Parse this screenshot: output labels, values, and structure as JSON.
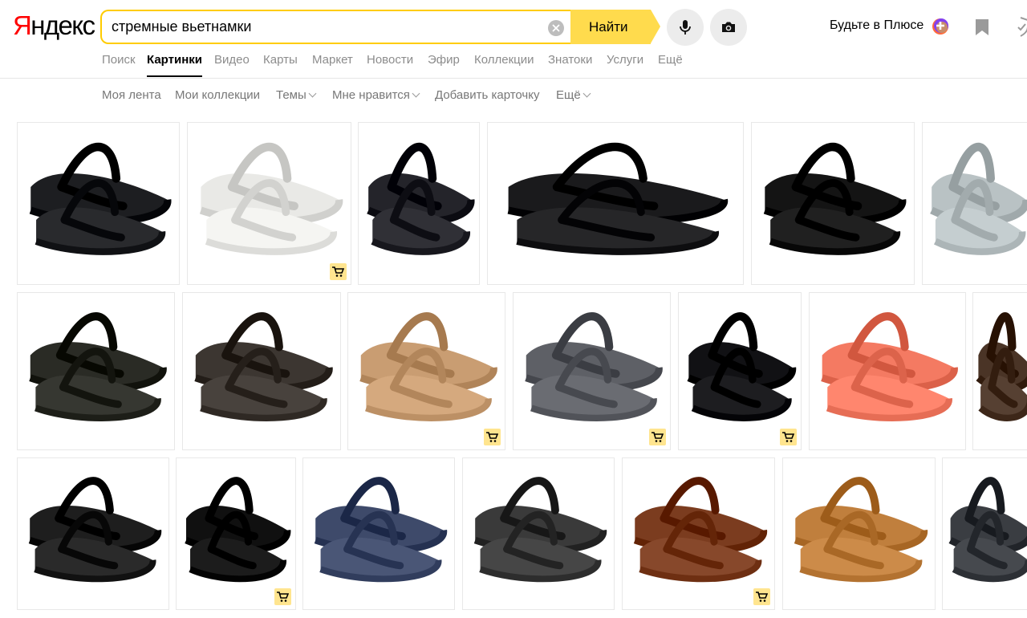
{
  "header": {
    "logo": "Яндекс",
    "search_value": "стремные вьетнамки",
    "find_label": "Найти",
    "plus_label": "Будьте в Плюсе",
    "icons": [
      "microphone-icon",
      "camera-icon",
      "plus-icon",
      "bookmark-icon",
      "shield-icon"
    ],
    "accent": "#ffdb4d"
  },
  "services": {
    "items": [
      "Поиск",
      "Картинки",
      "Видео",
      "Карты",
      "Маркет",
      "Новости",
      "Эфир",
      "Коллекции",
      "Знатоки",
      "Услуги",
      "Ещё"
    ],
    "active": "Картинки"
  },
  "subnav": {
    "items": [
      "Моя лента",
      "Мои коллекции",
      "Темы",
      "Мне нравится",
      "Добавить карточку",
      "Ещё"
    ]
  },
  "results": {
    "rows": [
      [
        {
          "kind": "black-grey sandal",
          "color": "#1d1e21",
          "cart": false
        },
        {
          "kind": "white-black flip-flops",
          "color": "#e9e9e6",
          "cart": true
        },
        {
          "kind": "black flip-flop",
          "color": "#24242a",
          "cart": false
        },
        {
          "kind": "black crocs sandal",
          "color": "#1a1a1c",
          "cart": false
        },
        {
          "kind": "black flip-flop",
          "color": "#141414",
          "cart": false
        },
        {
          "kind": "grey flip-flops",
          "color": "#b9c2c4",
          "cart": false
        }
      ],
      [
        {
          "kind": "black-yellow flip-flops",
          "color": "#2a2b25",
          "cart": false
        },
        {
          "kind": "dark brown flip-flops",
          "color": "#3c3631",
          "cart": false
        },
        {
          "kind": "tan flip-flops",
          "color": "#c99d72",
          "cart": true
        },
        {
          "kind": "grey patterned flip-flops",
          "color": "#5e6066",
          "cart": true
        },
        {
          "kind": "two black thong sandals",
          "color": "#111114",
          "cart": true
        },
        {
          "kind": "coral flip-flop",
          "color": "#f47a62",
          "cart": false
        },
        {
          "kind": "brown flip-flops",
          "color": "#4a3426",
          "cart": false
        }
      ],
      [
        {
          "kind": "black flip-flops",
          "color": "#1e1e1e",
          "cart": false
        },
        {
          "kind": "two black flip-flops",
          "color": "#101010",
          "cart": true
        },
        {
          "kind": "navy-white flip-flops",
          "color": "#3e4a6a",
          "cart": false
        },
        {
          "kind": "dark grey flip-flops",
          "color": "#3a3a3a",
          "cart": false
        },
        {
          "kind": "brown beaded flip-flops",
          "color": "#7b3c1f",
          "cart": true
        },
        {
          "kind": "tan flip-flops",
          "color": "#c07f3d",
          "cart": false
        },
        {
          "kind": "grey Roxy flip-flops",
          "color": "#3a3d42",
          "cart": false
        }
      ]
    ]
  }
}
